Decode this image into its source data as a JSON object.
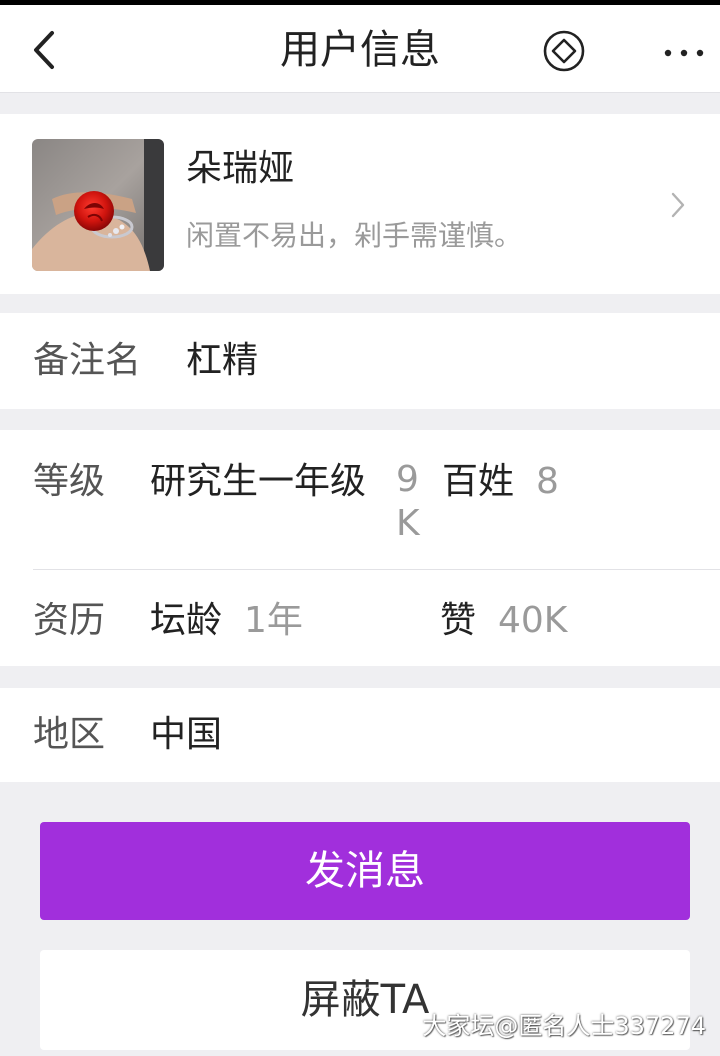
{
  "header": {
    "title": "用户信息",
    "back_icon": "chevron-left-icon",
    "diamond_icon": "diamond-circle-icon",
    "more_icon": "more-horizontal-icon"
  },
  "profile": {
    "name": "朵瑞娅",
    "bio": "闲置不易出，剁手需谨慎。",
    "avatar_desc": "red-rose-ring-photo"
  },
  "remark": {
    "label": "备注名",
    "value": "杠精"
  },
  "stats": {
    "level_label": "等级",
    "level_value": "研究生一年级",
    "level_number": "9K",
    "title_value": "百姓",
    "title_number": "8",
    "history_label": "资历",
    "age_label": "坛龄",
    "age_value": "1年",
    "likes_label": "赞",
    "likes_value": "40K"
  },
  "region": {
    "label": "地区",
    "value": "中国"
  },
  "actions": {
    "message_label": "发消息",
    "block_label": "屏蔽TA"
  },
  "watermark": "大家坛@匿名人士337274",
  "colors": {
    "accent": "#a12fdc",
    "background": "#efeff2",
    "muted_text": "#9a9a9a"
  }
}
